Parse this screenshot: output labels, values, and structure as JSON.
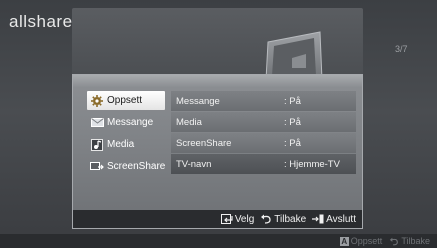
{
  "app": {
    "logo": "allshare"
  },
  "page_indicator": "3/7",
  "menu": {
    "items": [
      {
        "label": "Oppsett",
        "icon": "gear-icon",
        "selected": true
      },
      {
        "label": "Messange",
        "icon": "envelope-icon",
        "selected": false
      },
      {
        "label": "Media",
        "icon": "media-icon",
        "selected": false
      },
      {
        "label": "ScreenShare",
        "icon": "screenshare-icon",
        "selected": false
      }
    ]
  },
  "settings": {
    "rows": [
      {
        "label": "Messange",
        "value": ": På"
      },
      {
        "label": "Media",
        "value": ": På"
      },
      {
        "label": "ScreenShare",
        "value": ": På"
      },
      {
        "label": "TV-navn",
        "value": ": Hjemme-TV"
      }
    ]
  },
  "footer": {
    "select_label": "Velg",
    "back_label": "Tilbake",
    "exit_label": "Avslutt"
  },
  "bottom_bar": {
    "a_key": "A",
    "setup_label": "Oppsett",
    "back_label": "Tilbake"
  },
  "colors": {
    "background": "#3c3f43",
    "dialog": "#7e8185",
    "selected_menu": "#ffffff",
    "footer": "#2a2c2f"
  }
}
